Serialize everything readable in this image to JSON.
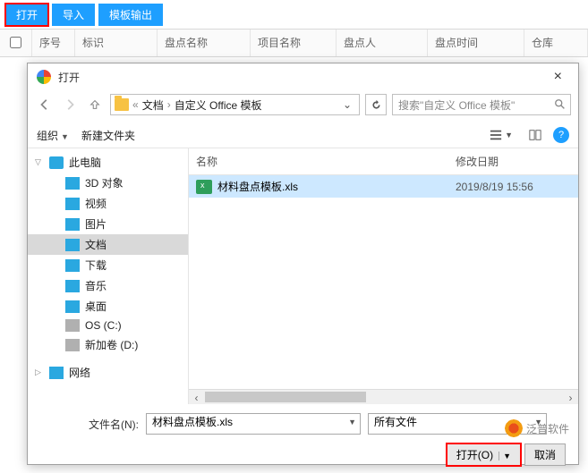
{
  "topbar": {
    "open": "打开",
    "import": "导入",
    "template_out": "模板输出"
  },
  "table": {
    "headers": [
      "序号",
      "标识",
      "盘点名称",
      "项目名称",
      "盘点人",
      "盘点时间",
      "仓库"
    ]
  },
  "dialog": {
    "title": "打开",
    "breadcrumb": {
      "pre": "«",
      "seg1": "文档",
      "seg2": "自定义 Office 模板"
    },
    "search_placeholder": "搜索\"自定义 Office 模板\"",
    "toolbar": {
      "organize": "组织",
      "newfolder": "新建文件夹"
    },
    "tree": {
      "root": "此电脑",
      "items": [
        "3D 对象",
        "视频",
        "图片",
        "文档",
        "下载",
        "音乐",
        "桌面",
        "OS (C:)",
        "新加卷 (D:)"
      ],
      "network": "网络"
    },
    "listhead": {
      "name": "名称",
      "mtime": "修改日期"
    },
    "file": {
      "name": "材料盘点模板.xls",
      "mtime": "2019/8/19 15:56"
    },
    "bottom": {
      "label": "文件名(N):",
      "filename_value": "材料盘点模板.xls",
      "type_value": "所有文件",
      "open_btn": "打开(O)",
      "cancel_btn": "取消"
    }
  },
  "watermark": "泛普软件"
}
